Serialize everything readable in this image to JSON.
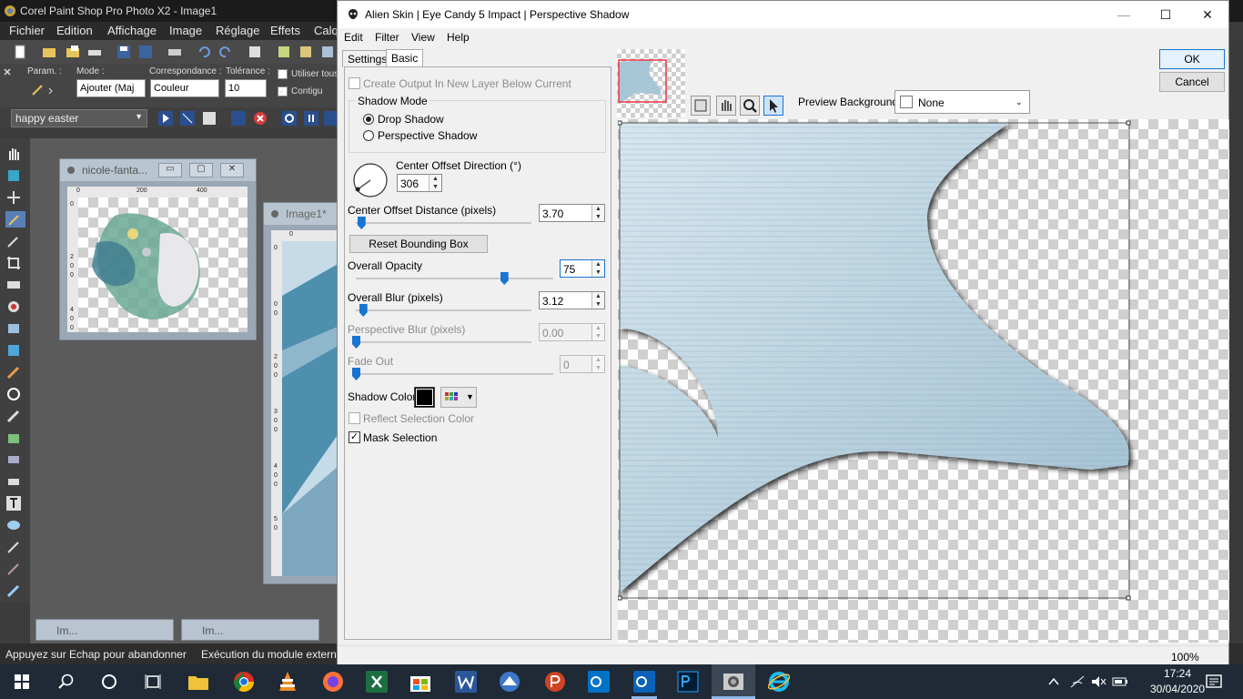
{
  "psp": {
    "title": "Corel Paint Shop Pro Photo X2 - Image1",
    "menu": [
      "Fichier",
      "Edition",
      "Affichage",
      "Image",
      "Réglage",
      "Effets",
      "Calq"
    ],
    "options": {
      "param_label": "Param. :",
      "mode_label": "Mode :",
      "mode_value": "Ajouter (Maj",
      "match_label": "Correspondance :",
      "match_value": "Couleur",
      "tolerance_label": "Tolérance :",
      "tolerance_value": "10",
      "use_all_label": "Utiliser tous",
      "contiguous_label": "Contigu"
    },
    "script_name": "happy easter",
    "window1": {
      "title": "nicole-fanta...",
      "ruler_ticks": [
        "0",
        "200",
        "400"
      ],
      "vruler_ticks": [
        "0",
        "2",
        "0",
        "0",
        "4",
        "0",
        "0"
      ]
    },
    "window2": {
      "title": "Image1*",
      "ruler_ticks": [
        "0"
      ],
      "vruler_ticks": [
        "0",
        "0",
        "0",
        "2",
        "0",
        "0",
        "3",
        "0",
        "0",
        "4",
        "0",
        "0",
        "5",
        "0"
      ]
    },
    "minimized": [
      "Im...",
      "Im..."
    ],
    "status_left": "Appuyez sur Echap pour abandonner",
    "status_right": "Exécution du module extern"
  },
  "dialog": {
    "title": "Alien Skin | Eye Candy 5 Impact | Perspective Shadow",
    "menu": [
      "Edit",
      "Filter",
      "View",
      "Help"
    ],
    "tabs": [
      "Settings",
      "Basic"
    ],
    "active_tab": "Basic",
    "create_output_label": "Create Output In New Layer Below Current",
    "shadow_mode_label": "Shadow Mode",
    "shadow_modes": [
      "Drop Shadow",
      "Perspective Shadow"
    ],
    "selected_mode": "Drop Shadow",
    "center_offset_direction_label": "Center Offset Direction (°)",
    "center_offset_direction_value": "306",
    "center_offset_distance_label": "Center Offset Distance (pixels)",
    "center_offset_distance_value": "3.70",
    "center_offset_distance_pos": 0.03,
    "reset_bounding_box_label": "Reset Bounding Box",
    "overall_opacity_label": "Overall Opacity",
    "overall_opacity_value": "75",
    "overall_opacity_pos": 0.75,
    "overall_blur_label": "Overall Blur (pixels)",
    "overall_blur_value": "3.12",
    "overall_blur_pos": 0.04,
    "perspective_blur_label": "Perspective Blur (pixels)",
    "perspective_blur_value": "0.00",
    "perspective_blur_pos": 0.0,
    "fade_out_label": "Fade Out",
    "fade_out_value": "0",
    "fade_out_pos": 0.0,
    "shadow_color_label": "Shadow Color",
    "shadow_color": "#000000",
    "reflect_selection_color_label": "Reflect Selection Color",
    "mask_selection_label": "Mask Selection",
    "mask_selection_checked": true,
    "preview_background_label": "Preview Background:",
    "preview_background_value": "None",
    "ok_label": "OK",
    "cancel_label": "Cancel",
    "zoom_label": "100%"
  },
  "taskbar": {
    "time": "17:24",
    "date": "30/04/2020"
  },
  "colors": {
    "accent": "#1874d2",
    "shape_light": "#d7e6ef",
    "shape_dark": "#9fbfd1",
    "taskbar": "#1f2a36"
  }
}
